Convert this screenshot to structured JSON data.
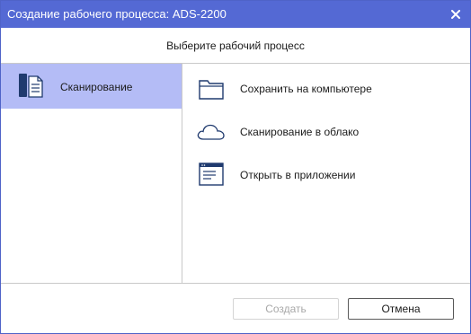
{
  "window": {
    "title": "Создание рабочего процесса: ADS-2200"
  },
  "header": {
    "instruction": "Выберите рабочий процесс"
  },
  "categories": [
    {
      "label": "Сканирование",
      "icon": "scan-document-icon",
      "selected": true
    }
  ],
  "options": [
    {
      "label": "Сохранить на компьютере",
      "icon": "folder-icon"
    },
    {
      "label": "Сканирование в облако",
      "icon": "cloud-icon"
    },
    {
      "label": "Открыть в приложении",
      "icon": "application-window-icon"
    }
  ],
  "footer": {
    "create_label": "Создать",
    "create_enabled": false,
    "cancel_label": "Отмена"
  },
  "colors": {
    "titlebar": "#5469d4",
    "selected_item": "#b4bcf6",
    "icon_stroke": "#1f3a6e"
  }
}
